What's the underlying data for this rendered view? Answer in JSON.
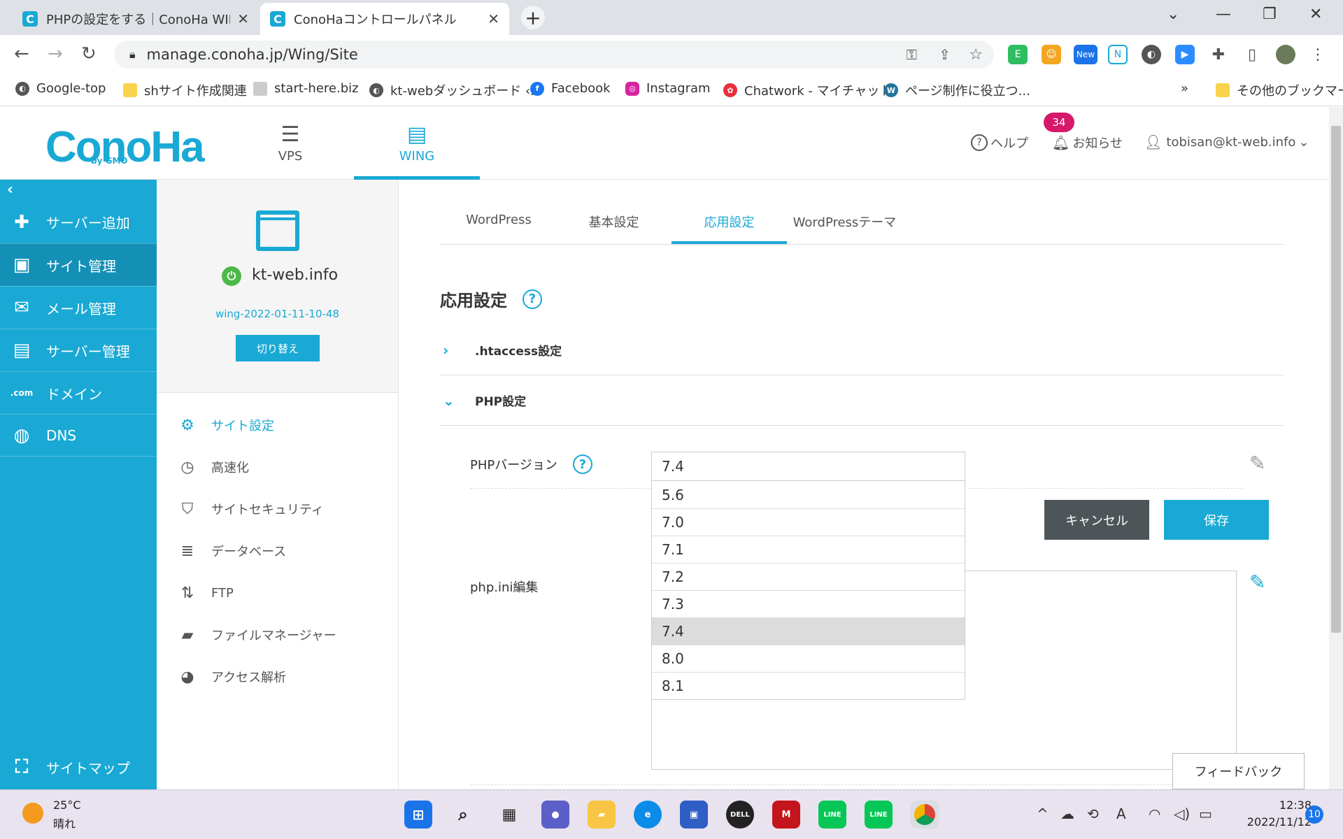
{
  "browser": {
    "tabs": [
      {
        "title": "PHPの設定をする｜ConoHa WING"
      },
      {
        "title": "ConoHaコントロールパネル"
      }
    ],
    "new_tab": "+",
    "url": "manage.conoha.jp/Wing/Site",
    "ext_new_label": "New",
    "bookmarks": [
      {
        "label": "Google-top"
      },
      {
        "label": "shサイト作成関連"
      },
      {
        "label": "start-here.biz"
      },
      {
        "label": "kt-webダッシュボード ‹..."
      },
      {
        "label": "Facebook"
      },
      {
        "label": "Instagram"
      },
      {
        "label": "Chatwork - マイチャット"
      },
      {
        "label": "ページ制作に役立つ..."
      }
    ],
    "bookmarks_more": "»",
    "other_bookmarks": "その他のブックマーク"
  },
  "header": {
    "logo": "ConoHa",
    "logo_sub": "by GMO",
    "nav": [
      {
        "label": "VPS",
        "icon": "server-icon"
      },
      {
        "label": "WING",
        "icon": "wing-icon"
      }
    ],
    "help": "ヘルプ",
    "notice": "お知らせ",
    "notice_count": "34",
    "user": "tobisan@kt-web.info"
  },
  "sidebar": {
    "items": [
      {
        "label": "サーバー追加",
        "icon": "plus-icon"
      },
      {
        "label": "サイト管理",
        "icon": "site-icon"
      },
      {
        "label": "メール管理",
        "icon": "mail-icon"
      },
      {
        "label": "サーバー管理",
        "icon": "server-manage-icon"
      },
      {
        "label": "ドメイン",
        "icon": "domain-icon"
      },
      {
        "label": "DNS",
        "icon": "globe-icon"
      }
    ],
    "sitemap": "サイトマップ"
  },
  "site": {
    "name": "kt-web.info",
    "id": "wing-2022-01-11-10-48",
    "switch": "切り替え",
    "menu": [
      {
        "label": "サイト設定",
        "icon": "site-settings-icon"
      },
      {
        "label": "高速化",
        "icon": "stopwatch-icon"
      },
      {
        "label": "サイトセキュリティ",
        "icon": "shield-icon"
      },
      {
        "label": "データベース",
        "icon": "database-icon"
      },
      {
        "label": "FTP",
        "icon": "transfer-icon"
      },
      {
        "label": "ファイルマネージャー",
        "icon": "folder-icon"
      },
      {
        "label": "アクセス解析",
        "icon": "pie-chart-icon"
      }
    ]
  },
  "main": {
    "tabs": [
      {
        "label": "WordPress"
      },
      {
        "label": "基本設定"
      },
      {
        "label": "応用設定"
      },
      {
        "label": "WordPressテーマ"
      }
    ],
    "title": "応用設定",
    "htaccess": ".htaccess設定",
    "php": "PHP設定",
    "php_version_label": "PHPバージョン",
    "php_version_value": "7.4",
    "php_options": [
      "5.6",
      "7.0",
      "7.1",
      "7.2",
      "7.3",
      "7.4",
      "8.0",
      "8.1"
    ],
    "selected_option": "7.4",
    "cancel": "キャンセル",
    "save": "保存",
    "phpini_label": "php.ini編集",
    "feedback": "フィードバック"
  },
  "taskbar": {
    "temp": "25°C",
    "weather": "晴れ",
    "time": "12:38",
    "date": "2022/11/12",
    "notifications": "10"
  },
  "colors": {
    "accent": "#19a9d4",
    "sidebar_active": "#1490b7",
    "cancel": "#4d5558",
    "badge": "#d6186a"
  }
}
